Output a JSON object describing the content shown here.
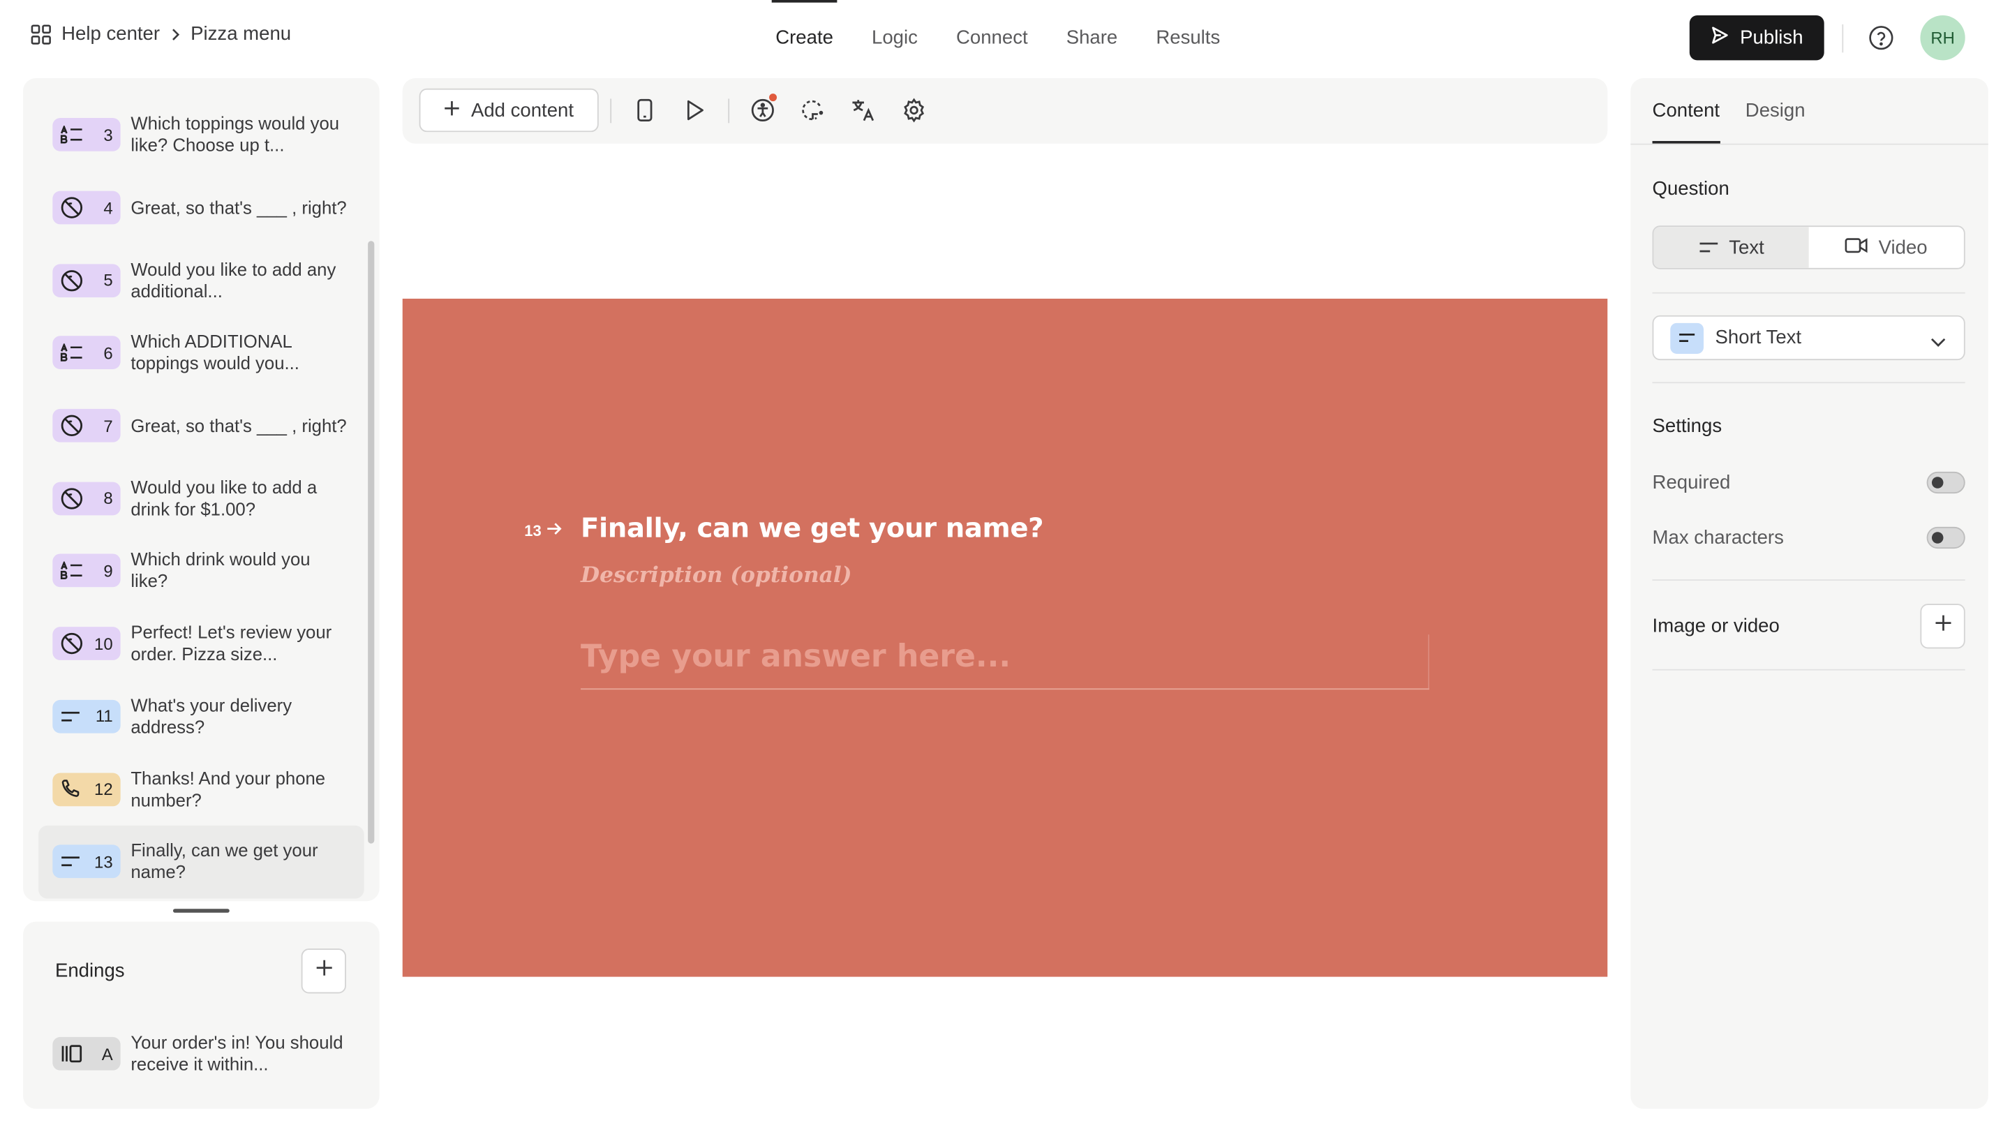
{
  "breadcrumb": {
    "parent": "Help center",
    "current": "Pizza menu"
  },
  "nav": {
    "tabs": [
      "Create",
      "Logic",
      "Connect",
      "Share",
      "Results"
    ],
    "active": "Create"
  },
  "header": {
    "publish_label": "Publish",
    "avatar_initials": "RH"
  },
  "questions": [
    {
      "num": "3",
      "type": "multiple-choice",
      "text": "Which toppings would you like? Choose up t..."
    },
    {
      "num": "4",
      "type": "statement",
      "text": "Great, so that's ___ , right?"
    },
    {
      "num": "5",
      "type": "statement",
      "text": "Would you like to add any additional..."
    },
    {
      "num": "6",
      "type": "multiple-choice",
      "text": "Which ADDITIONAL toppings would you..."
    },
    {
      "num": "7",
      "type": "statement",
      "text": "Great, so that's ___ , right?"
    },
    {
      "num": "8",
      "type": "statement",
      "text": "Would you like to add a drink for $1.00?"
    },
    {
      "num": "9",
      "type": "multiple-choice",
      "text": "Which drink would you like?"
    },
    {
      "num": "10",
      "type": "statement",
      "text": "Perfect! Let's review your order. Pizza size..."
    },
    {
      "num": "11",
      "type": "short-text",
      "text": "What's your delivery address?"
    },
    {
      "num": "12",
      "type": "phone",
      "text": "Thanks! And your phone number?"
    },
    {
      "num": "13",
      "type": "short-text",
      "text": "Finally, can we get your name?"
    }
  ],
  "endings": {
    "title": "Endings",
    "items": [
      {
        "label": "A",
        "text": "Your order's in! You should receive it within..."
      }
    ]
  },
  "toolbar": {
    "add_content_label": "Add content"
  },
  "stage": {
    "number": "13",
    "title": "Finally, can we get your name?",
    "description_placeholder": "Description (optional)",
    "answer_placeholder": "Type your answer here..."
  },
  "right_panel": {
    "tabs": [
      "Content",
      "Design"
    ],
    "question_title": "Question",
    "segment": [
      "Text",
      "Video"
    ],
    "type_label": "Short Text",
    "settings_title": "Settings",
    "settings": [
      "Required",
      "Max characters"
    ],
    "image_label": "Image or video"
  },
  "colors": {
    "stage_bg": "#d3715f",
    "multiple_choice_badge": "#e3d3f7",
    "statement_badge": "#e3d3f7",
    "short_text_badge": "#c7defa",
    "phone_badge": "#f3d9a8",
    "ending_badge": "#dcdcdc",
    "publish_bg": "#19191a"
  }
}
